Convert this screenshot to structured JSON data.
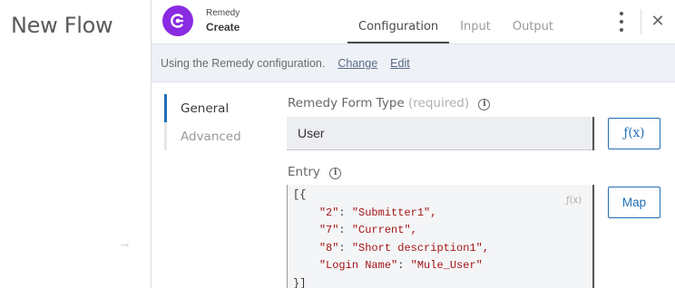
{
  "flow": {
    "title": "New Flow",
    "arrow_icon": "→"
  },
  "header": {
    "connector_name": "Remedy",
    "operation_name": "Create",
    "icon": "remedy-logo-icon",
    "accent_color": "#8a2be2",
    "tabs": [
      {
        "label": "Configuration",
        "active": true
      },
      {
        "label": "Input",
        "active": false
      },
      {
        "label": "Output",
        "active": false
      }
    ],
    "close_icon": "✕"
  },
  "config_bar": {
    "text": "Using the Remedy configuration.",
    "change_label": "Change",
    "edit_label": "Edit"
  },
  "side_nav": {
    "items": [
      {
        "label": "General",
        "active": true
      },
      {
        "label": "Advanced",
        "active": false
      }
    ]
  },
  "form_type": {
    "label": "Remedy Form Type",
    "required": "(required)",
    "value": "User",
    "fx_label": "ƒ(x)"
  },
  "entry": {
    "label": "Entry",
    "fx_hint": "ƒ(x)",
    "map_label": "Map",
    "lines": [
      {
        "key": "",
        "value": "",
        "raw": "[{"
      },
      {
        "key": "\"2\"",
        "value": "\"Submitter1\","
      },
      {
        "key": "\"7\"",
        "value": "\"Current\","
      },
      {
        "key": "\"8\"",
        "value": "\"Short description1\","
      },
      {
        "key": "\"Login Name\"",
        "value": "\"Mule_User\""
      },
      {
        "key": "",
        "value": "",
        "raw": "}]"
      }
    ]
  },
  "colors": {
    "link": "#1f6fb5",
    "code_string": "#a31515",
    "config_bar_bg": "#eef1f6"
  }
}
